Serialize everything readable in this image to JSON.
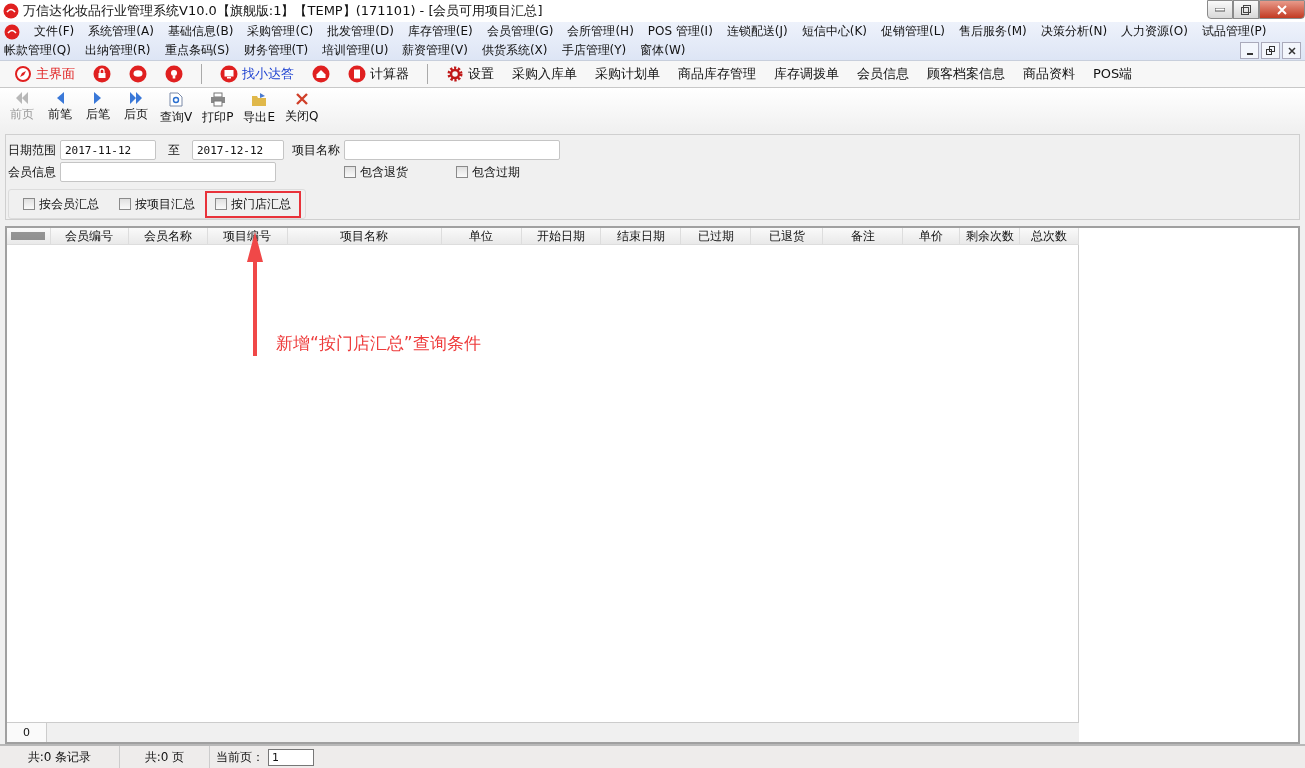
{
  "window": {
    "title": "万信达化妆品行业管理系统V10.0【旗舰版:1】【TEMP】(171101) - [会员可用项目汇总]"
  },
  "menu_rows": [
    [
      "文件(F)",
      "系统管理(A)",
      "基础信息(B)",
      "采购管理(C)",
      "批发管理(D)",
      "库存管理(E)",
      "会员管理(G)",
      "会所管理(H)",
      "POS 管理(I)",
      "连锁配送(J)",
      "短信中心(K)",
      "促销管理(L)",
      "售后服务(M)",
      "决策分析(N)",
      "人力资源(O)",
      "试品管理(P)"
    ],
    [
      "帐款管理(Q)",
      "出纳管理(R)",
      "重点条码(S)",
      "财务管理(T)",
      "培训管理(U)",
      "薪资管理(V)",
      "供货系统(X)",
      "手店管理(Y)",
      "窗体(W)"
    ]
  ],
  "quick_bar": [
    {
      "kind": "labeled",
      "label": "主界面",
      "color": "#e02020"
    },
    {
      "kind": "icon"
    },
    {
      "kind": "icon"
    },
    {
      "kind": "icon"
    },
    {
      "kind": "separator"
    },
    {
      "kind": "labeled",
      "label": "找小达答",
      "color": "#1a3fd0"
    },
    {
      "kind": "icon"
    },
    {
      "kind": "labeled",
      "label": "计算器"
    },
    {
      "kind": "separator"
    },
    {
      "kind": "labeled",
      "label": "设置"
    },
    {
      "kind": "text",
      "label": "采购入库单"
    },
    {
      "kind": "text",
      "label": "采购计划单"
    },
    {
      "kind": "text",
      "label": "商品库存管理"
    },
    {
      "kind": "text",
      "label": "库存调拨单"
    },
    {
      "kind": "text",
      "label": "会员信息"
    },
    {
      "kind": "text",
      "label": "顾客档案信息"
    },
    {
      "kind": "text",
      "label": "商品资料"
    },
    {
      "kind": "text",
      "label": "POS端"
    }
  ],
  "nav_bar": [
    {
      "label": "前页",
      "disabled": true
    },
    {
      "label": "前笔",
      "disabled": false
    },
    {
      "label": "后笔",
      "disabled": false
    },
    {
      "label": "后页",
      "disabled": false
    },
    {
      "label": "查询V",
      "disabled": false
    },
    {
      "label": "打印P",
      "disabled": false
    },
    {
      "label": "导出E",
      "disabled": false
    },
    {
      "label": "关闭Q",
      "disabled": false
    }
  ],
  "filters": {
    "date_label": "日期范围",
    "date_from": "2017-11-12",
    "to_label": "至",
    "date_to": "2017-12-12",
    "item_label": "项目名称",
    "member_label": "会员信息",
    "options": [
      {
        "label": "包含退货",
        "checked": false
      },
      {
        "label": "包含过期",
        "checked": false
      }
    ],
    "group_by": [
      {
        "label": "按会员汇总",
        "checked": false,
        "highlighted": false
      },
      {
        "label": "按项目汇总",
        "checked": false,
        "highlighted": false
      },
      {
        "label": "按门店汇总",
        "checked": false,
        "highlighted": true
      }
    ]
  },
  "table": {
    "columns": [
      "会员编号",
      "会员名称",
      "项目编号",
      "项目名称",
      "单位",
      "开始日期",
      "结束日期",
      "已过期",
      "已退货",
      "备注",
      "单价",
      "剩余次数",
      "总次数"
    ],
    "footer_count": "0"
  },
  "annotation": {
    "text": "新增“按门店汇总”查询条件"
  },
  "status_bar": {
    "records": "共:0 条记录",
    "pages": "共:0 页",
    "current_label": "当前页：",
    "current_page": "1"
  }
}
